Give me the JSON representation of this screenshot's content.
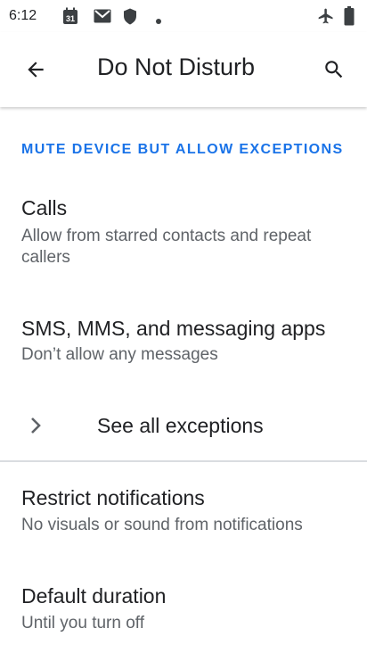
{
  "status_bar": {
    "time": "6:12",
    "icons": [
      "calendar-icon",
      "gmail-icon",
      "shield-icon",
      "dot-icon",
      "airplane-icon",
      "battery-icon"
    ]
  },
  "app_bar": {
    "title": "Do Not Disturb",
    "back_icon": "arrow-back-icon",
    "search_icon": "search-icon"
  },
  "section": {
    "header": "MUTE DEVICE BUT ALLOW EXCEPTIONS"
  },
  "calls": {
    "title": "Calls",
    "summary": "Allow from starred contacts and repeat callers"
  },
  "messages": {
    "title": "SMS, MMS, and messaging apps",
    "summary": "Don’t allow any messages"
  },
  "see_all": {
    "label": "See all exceptions"
  },
  "restrict": {
    "title": "Restrict notifications",
    "summary": "No visuals or sound from notifications"
  },
  "duration": {
    "title": "Default duration",
    "summary": "Until you turn off"
  },
  "colors": {
    "accent": "#1a73e8",
    "primary_text": "#202124",
    "secondary_text": "#5f6368"
  }
}
